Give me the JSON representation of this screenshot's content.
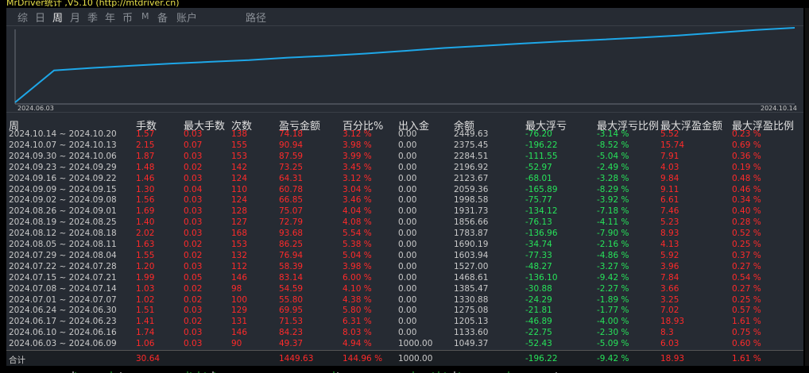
{
  "window": {
    "title": "MrDriver统计 ,V5.10 (http://mtdriver.cn)"
  },
  "tabs": [
    {
      "label": "综",
      "active": false
    },
    {
      "label": "日",
      "active": false
    },
    {
      "label": "周",
      "active": true
    },
    {
      "label": "月",
      "active": false
    },
    {
      "label": "季",
      "active": false
    },
    {
      "label": "年",
      "active": false
    },
    {
      "label": "币",
      "active": false
    },
    {
      "label": "M",
      "active": false
    },
    {
      "label": "备",
      "active": false
    },
    {
      "label": "账户",
      "active": false
    },
    {
      "label": "路径",
      "active": false
    }
  ],
  "chart": {
    "start_label": "2024.06.03",
    "end_label": "2024.10.14",
    "line_color": "#1ea7e8"
  },
  "table": {
    "headers": [
      "周",
      "手数",
      "最大手数",
      "次数",
      "盈亏金额",
      "百分比%",
      "出入金",
      "余额",
      "最大浮亏",
      "最大浮亏比例",
      "最大浮盈金额",
      "最大浮盈比例"
    ],
    "rows": [
      [
        "2024.10.14 ~ 2024.10.20",
        "1.57",
        "0.03",
        "138",
        "74.18",
        "3.12 %",
        "0.00",
        "2449.63",
        "-76.20",
        "-3.14 %",
        "5.52",
        "0.23 %"
      ],
      [
        "2024.10.07 ~ 2024.10.13",
        "2.15",
        "0.07",
        "155",
        "90.94",
        "3.98 %",
        "0.00",
        "2375.45",
        "-196.22",
        "-8.52 %",
        "15.74",
        "0.69 %"
      ],
      [
        "2024.09.30 ~ 2024.10.06",
        "1.87",
        "0.03",
        "153",
        "87.59",
        "3.99 %",
        "0.00",
        "2284.51",
        "-111.55",
        "-5.04 %",
        "7.91",
        "0.36 %"
      ],
      [
        "2024.09.23 ~ 2024.09.29",
        "1.48",
        "0.02",
        "142",
        "73.25",
        "3.45 %",
        "0.00",
        "2196.92",
        "-52.97",
        "-2.49 %",
        "4.03",
        "0.19 %"
      ],
      [
        "2024.09.16 ~ 2024.09.22",
        "1.46",
        "0.03",
        "124",
        "64.31",
        "3.12 %",
        "0.00",
        "2123.67",
        "-68.01",
        "-3.28 %",
        "9.84",
        "0.48 %"
      ],
      [
        "2024.09.09 ~ 2024.09.15",
        "1.30",
        "0.04",
        "110",
        "60.78",
        "3.04 %",
        "0.00",
        "2059.36",
        "-165.89",
        "-8.29 %",
        "9.11",
        "0.46 %"
      ],
      [
        "2024.09.02 ~ 2024.09.08",
        "1.56",
        "0.03",
        "124",
        "66.85",
        "3.46 %",
        "0.00",
        "1998.58",
        "-75.77",
        "-3.92 %",
        "6.61",
        "0.34 %"
      ],
      [
        "2024.08.26 ~ 2024.09.01",
        "1.69",
        "0.03",
        "128",
        "75.07",
        "4.04 %",
        "0.00",
        "1931.73",
        "-134.12",
        "-7.18 %",
        "7.46",
        "0.40 %"
      ],
      [
        "2024.08.19 ~ 2024.08.25",
        "1.40",
        "0.03",
        "127",
        "72.79",
        "4.08 %",
        "0.00",
        "1856.66",
        "-76.13",
        "-4.11 %",
        "5.23",
        "0.28 %"
      ],
      [
        "2024.08.12 ~ 2024.08.18",
        "2.02",
        "0.03",
        "168",
        "93.68",
        "5.54 %",
        "0.00",
        "1783.87",
        "-136.96",
        "-7.90 %",
        "8.93",
        "0.52 %"
      ],
      [
        "2024.08.05 ~ 2024.08.11",
        "1.63",
        "0.02",
        "153",
        "86.25",
        "5.38 %",
        "0.00",
        "1690.19",
        "-34.74",
        "-2.16 %",
        "4.13",
        "0.25 %"
      ],
      [
        "2024.07.29 ~ 2024.08.04",
        "1.55",
        "0.02",
        "132",
        "76.94",
        "5.04 %",
        "0.00",
        "1603.94",
        "-77.33",
        "-4.86 %",
        "5.92",
        "0.37 %"
      ],
      [
        "2024.07.22 ~ 2024.07.28",
        "1.20",
        "0.03",
        "112",
        "58.39",
        "3.98 %",
        "0.00",
        "1527.00",
        "-48.27",
        "-3.27 %",
        "3.96",
        "0.27 %"
      ],
      [
        "2024.07.15 ~ 2024.07.21",
        "1.99",
        "0.05",
        "146",
        "83.14",
        "6.00 %",
        "0.00",
        "1468.61",
        "-136.10",
        "-9.42 %",
        "7.84",
        "0.54 %"
      ],
      [
        "2024.07.08 ~ 2024.07.14",
        "1.03",
        "0.02",
        "98",
        "54.59",
        "4.10 %",
        "0.00",
        "1385.47",
        "-30.88",
        "-2.27 %",
        "3.66",
        "0.27 %"
      ],
      [
        "2024.07.01 ~ 2024.07.07",
        "1.02",
        "0.02",
        "100",
        "55.80",
        "4.38 %",
        "0.00",
        "1330.88",
        "-24.29",
        "-1.89 %",
        "3.25",
        "0.25 %"
      ],
      [
        "2024.06.24 ~ 2024.06.30",
        "1.51",
        "0.03",
        "129",
        "69.95",
        "5.80 %",
        "0.00",
        "1275.08",
        "-21.81",
        "-1.77 %",
        "7.02",
        "0.57 %"
      ],
      [
        "2024.06.17 ~ 2024.06.23",
        "1.41",
        "0.02",
        "131",
        "71.53",
        "6.31 %",
        "0.00",
        "1205.13",
        "-46.89",
        "-4.00 %",
        "18.93",
        "1.61 %"
      ],
      [
        "2024.06.10 ~ 2024.06.16",
        "1.74",
        "0.03",
        "146",
        "84.23",
        "8.03 %",
        "0.00",
        "1133.60",
        "-22.75",
        "-2.30 %",
        "8.3",
        "0.75 %"
      ],
      [
        "2024.06.03 ~ 2024.06.09",
        "1.06",
        "0.03",
        "90",
        "49.37",
        "4.94 %",
        "1000.00",
        "1049.37",
        "-52.43",
        "-5.09 %",
        "6.03",
        "0.60 %"
      ]
    ],
    "total": [
      "合计",
      "30.64",
      "",
      "",
      "1449.63",
      "144.96 %",
      "1000.00",
      "",
      "-196.22",
      "-9.42 %",
      "18.93",
      "1.61 %"
    ]
  },
  "colors": {
    "positive": "#ff2a2a",
    "negative": "#27e35a",
    "neutral": "#c9c9c9"
  }
}
